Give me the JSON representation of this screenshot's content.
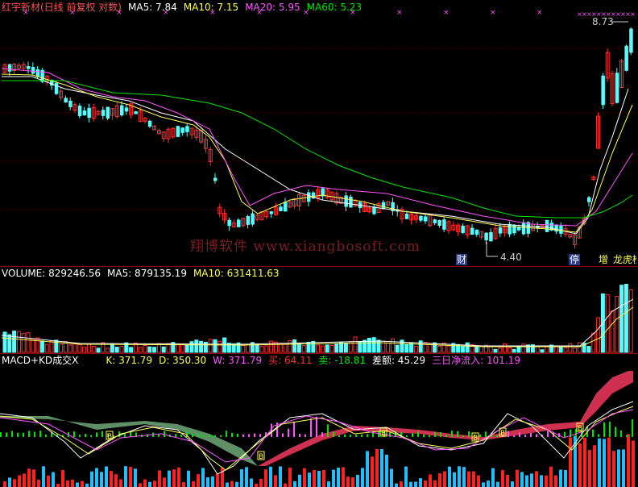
{
  "price_panel": {
    "title": "红宇新材(日线 前复权 对数)",
    "ma5": "MA5: 7.84",
    "ma10": "MA10: 7.15",
    "ma20": "MA20: 5.95",
    "ma60": "MA60: 5.23",
    "high_label": "8.73",
    "low_label": "4.40",
    "watermark": "翔博软件 www.xiangbosoft.com",
    "tags": {
      "cai": "财",
      "ting": "停",
      "zeng": "增",
      "bang": "龙虎榜"
    }
  },
  "volume_panel": {
    "volume": "VOLUME: 829246.56",
    "ma5": "MA5: 879135.19",
    "ma10": "MA10: 631411.63"
  },
  "indicator_panel": {
    "name": "MACD+KD成交X",
    "k": "K: 371.79",
    "d": "D: 350.30",
    "w": "W: 371.79",
    "buy": "买: 64.11",
    "sell": "卖: -18.81",
    "diff": "差额: 45.29",
    "net3": "三日净流入: 101.19",
    "marker_letter": "B"
  },
  "colors": {
    "up": "#ff3030",
    "down": "#54ffff",
    "ma5": "#ffffff",
    "ma10": "#ffff54",
    "ma20": "#ff54ff",
    "ma60": "#00e600",
    "separator": "#8b0000"
  }
}
